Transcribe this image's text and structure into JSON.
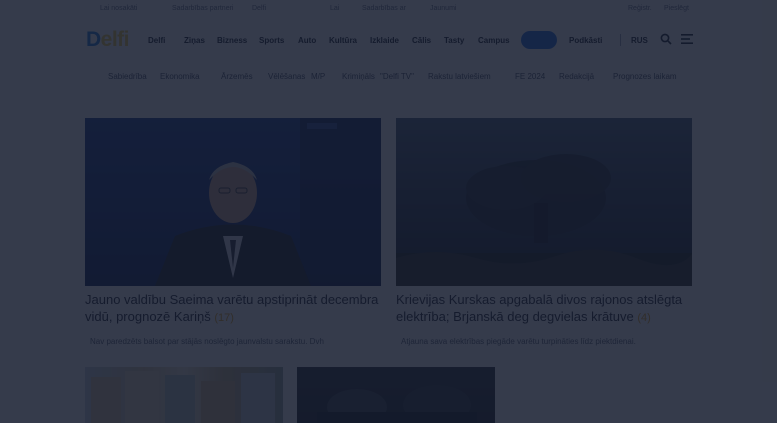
{
  "topbar": {
    "items": [
      "Lai nosakāti",
      "Sadarbības partneri",
      "Delfi",
      "Lai",
      "Sadarbības ar",
      "Jaunumi"
    ],
    "right_items": [
      "Reģistr.",
      "Pieslēgt"
    ]
  },
  "header": {
    "logo": {
      "d": "D",
      "rest": "elfi"
    },
    "nav": [
      "Delfi",
      "Ziņas",
      "Bizness",
      "Sports",
      "Auto",
      "Kultūra",
      "Izklaide",
      "Cālis",
      "Tasty",
      "Campus"
    ],
    "shop_label": "",
    "podcasts": "Podkāsti",
    "lang": "RUS"
  },
  "subnav": {
    "items": [
      "Sabiedrība",
      "Ekonomika",
      "Ārzemēs",
      "Vēlēšanas",
      "M/P",
      "Krimiņāls",
      "\"Delfi TV\"",
      "Rakstu latviešiem",
      "FE 2024",
      "Redakcijā",
      "Prognozes laikam"
    ]
  },
  "articles": [
    {
      "title": "Jauno valdību Saeima varētu apstiprināt decembra vidū, prognozē Kariņš",
      "comment_count": "(17)",
      "lead": "Nav paredzēts balsot par stājās noslēgto jaunvalstu sarakstu. Dvh"
    },
    {
      "title": "Krievijas Kurskas apgabalā divos rajonos atslēgta elektrība; Brjanskā deg degvielas krātuve",
      "comment_count": "(4)",
      "lead": "Atjauna sava elektrības piegāde varētu turpināties līdz piektdienai."
    },
    {
      "title": "",
      "comment_count": "",
      "lead": ""
    },
    {
      "title": "",
      "comment_count": "",
      "lead": ""
    }
  ],
  "colors": {
    "logo_blue": "#1d7bd8",
    "logo_yellow": "#f2c94c",
    "accent_pill": "#1f6ee0",
    "comment_count": "#e0a020"
  }
}
